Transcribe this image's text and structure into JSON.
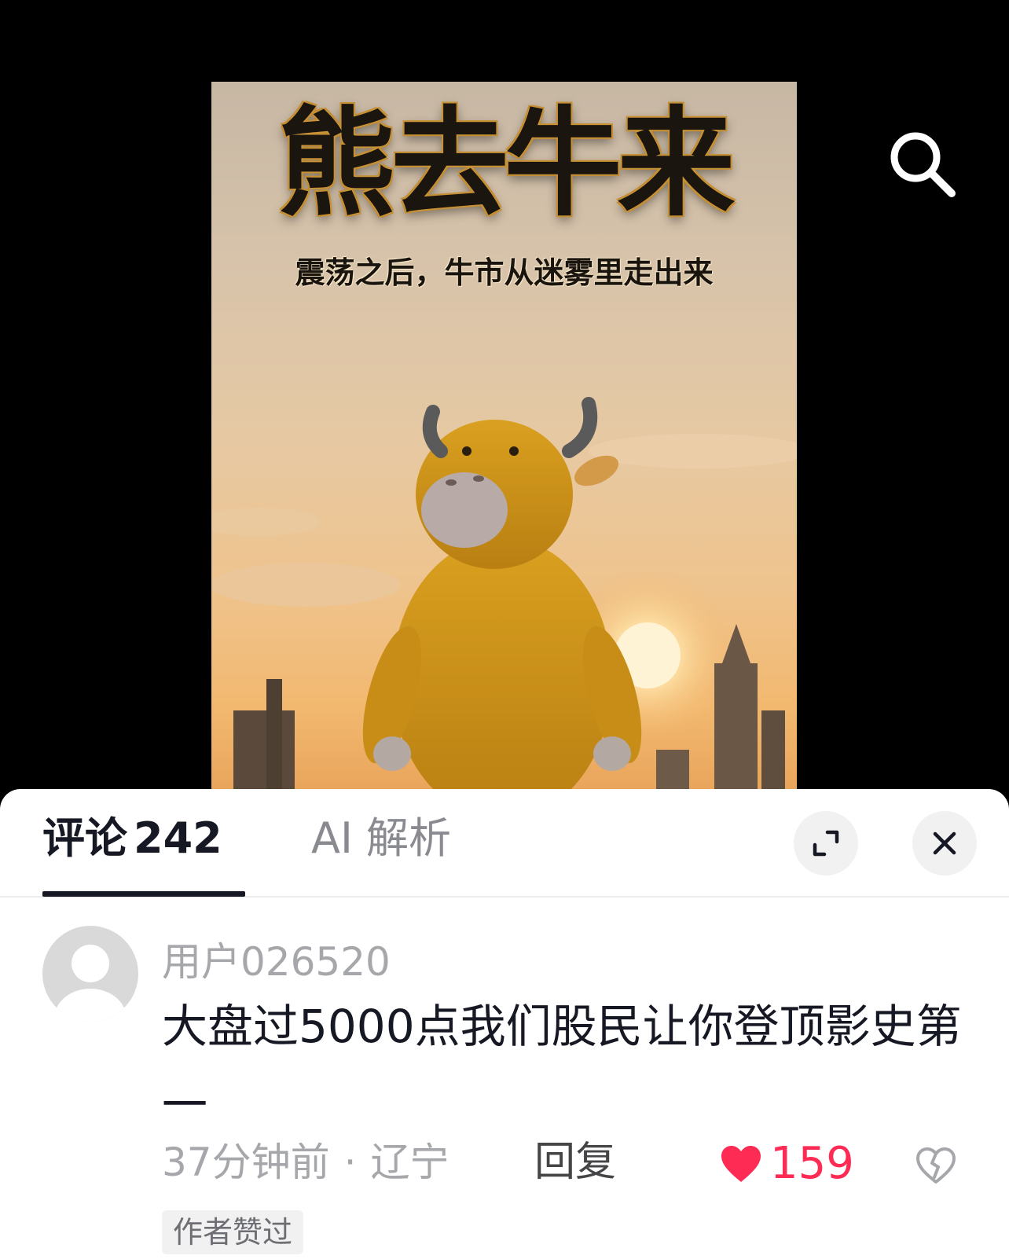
{
  "poster": {
    "title": "熊去牛来",
    "subtitle": "震荡之后，牛市从迷雾里走出来"
  },
  "icons": {
    "search": "search-icon",
    "expand": "expand-icon",
    "close": "close-icon",
    "like": "heart-icon",
    "dislike": "broken-heart-icon",
    "avatar": "default-avatar-icon"
  },
  "tabs": {
    "comments_label": "评论",
    "comments_count": "242",
    "ai_label": "AI 解析"
  },
  "comment": {
    "username": "用户026520",
    "text": "大盘过5000点我们股民让你登顶影史第一",
    "time": "37分钟前",
    "separator": "·",
    "location": "辽宁",
    "reply_label": "回复",
    "likes": "159",
    "badge": "作者赞过"
  },
  "colors": {
    "like": "#fe2c55",
    "primary_text": "#161823",
    "secondary_text": "#a6a7ab"
  }
}
